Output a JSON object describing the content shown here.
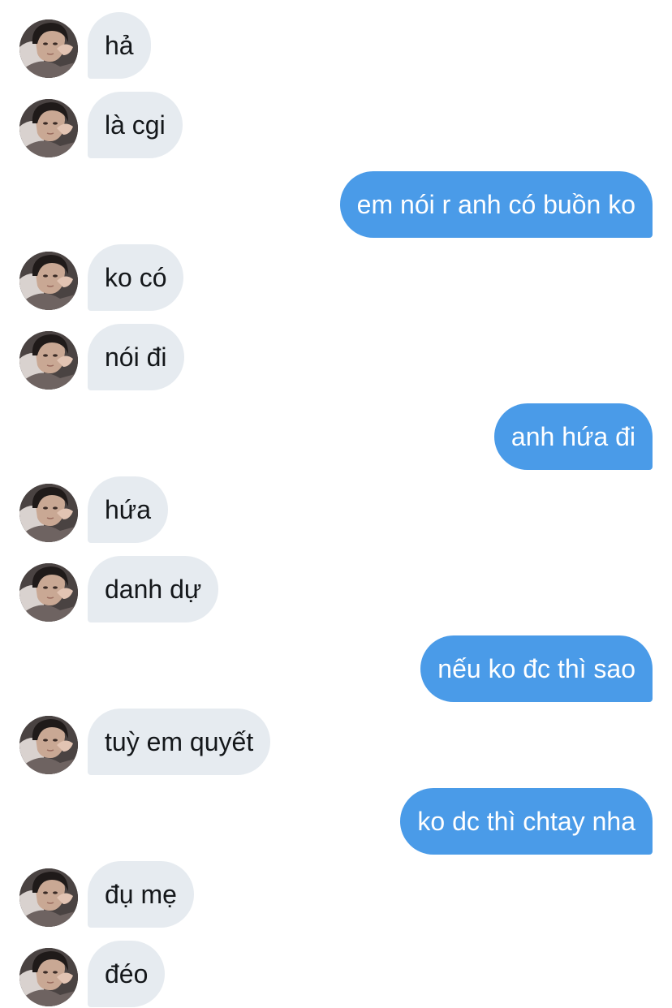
{
  "conversation": {
    "messages": [
      {
        "sender": "them",
        "text": "hả"
      },
      {
        "sender": "them",
        "text": "là cgi"
      },
      {
        "sender": "me",
        "text": "em nói r anh có buồn ko"
      },
      {
        "sender": "them",
        "text": "ko có"
      },
      {
        "sender": "them",
        "text": "nói đi"
      },
      {
        "sender": "me",
        "text": "anh hứa đi"
      },
      {
        "sender": "them",
        "text": "hứa"
      },
      {
        "sender": "them",
        "text": "danh dự"
      },
      {
        "sender": "me",
        "text": "nếu ko đc thì sao"
      },
      {
        "sender": "them",
        "text": "tuỳ em quyết"
      },
      {
        "sender": "me",
        "text": "ko dc thì chtay nha"
      },
      {
        "sender": "them",
        "text": "đụ mẹ"
      },
      {
        "sender": "them",
        "text": "đéo"
      }
    ]
  },
  "colors": {
    "background": "#ffffff",
    "incoming_bubble": "#e6ebf0",
    "incoming_text": "#14171a",
    "outgoing_bubble": "#4a9be8",
    "outgoing_text": "#ffffff"
  },
  "icons": {
    "avatar": "contact-avatar-photo"
  }
}
